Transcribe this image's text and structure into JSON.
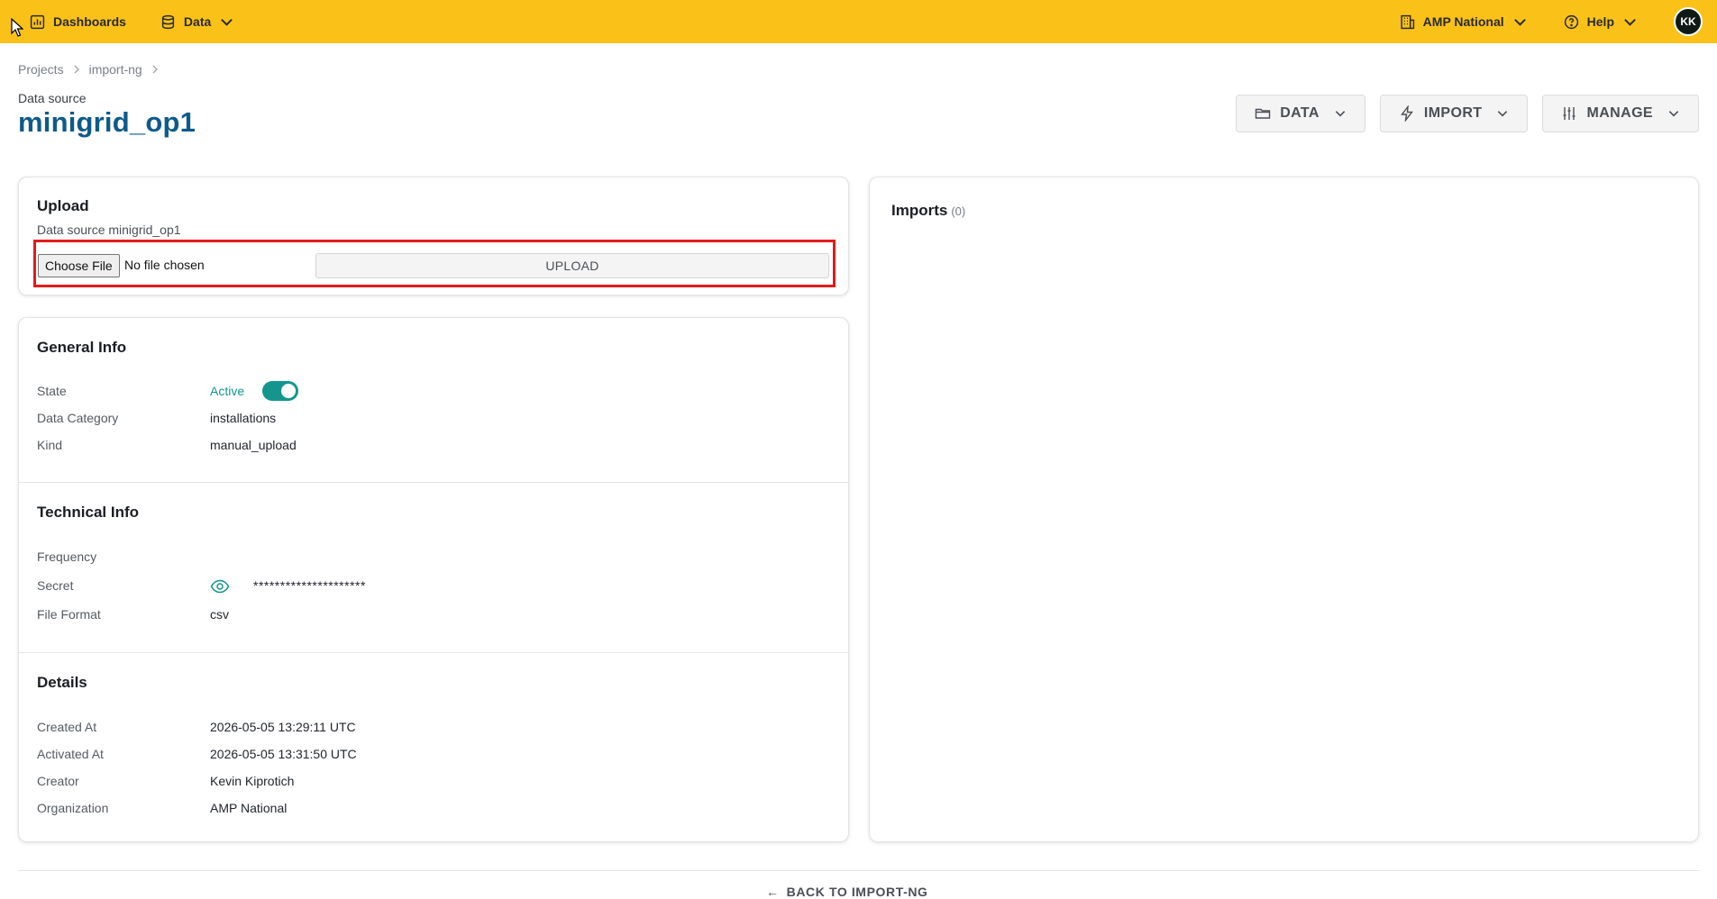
{
  "topbar": {
    "dashboards_label": "Dashboards",
    "data_label": "Data",
    "org_label": "AMP National",
    "help_label": "Help",
    "avatar_initials": "KK"
  },
  "breadcrumb": [
    "Projects",
    "import-ng"
  ],
  "header": {
    "subtitle": "Data source",
    "title": "minigrid_op1"
  },
  "actions": [
    {
      "label": "DATA",
      "icon": "folder-icon"
    },
    {
      "label": "IMPORT",
      "icon": "lightning-icon"
    },
    {
      "label": "MANAGE",
      "icon": "sliders-icon"
    }
  ],
  "upload": {
    "title": "Upload",
    "description": "Data source minigrid_op1",
    "choose_file_label": "Choose File",
    "file_status": "No file chosen",
    "upload_label": "UPLOAD"
  },
  "general_info": {
    "title": "General Info",
    "state_label": "State",
    "state_value": "Active",
    "state_on": true,
    "category_label": "Data Category",
    "category_value": "installations",
    "kind_label": "Kind",
    "kind_value": "manual_upload"
  },
  "technical_info": {
    "title": "Technical Info",
    "frequency_label": "Frequency",
    "frequency_value": "",
    "secret_label": "Secret",
    "secret_value": "*********************",
    "format_label": "File Format",
    "format_value": "csv"
  },
  "details": {
    "title": "Details",
    "created_label": "Created At",
    "created_value": "2026-05-05 13:29:11 UTC",
    "activated_label": "Activated At",
    "activated_value": "2026-05-05 13:31:50 UTC",
    "creator_label": "Creator",
    "creator_value": "Kevin Kiprotich",
    "org_label": "Organization",
    "org_value": "AMP National"
  },
  "imports": {
    "title": "Imports",
    "count": "(0)"
  },
  "footer": {
    "back_label": "BACK TO IMPORT-NG"
  },
  "colors": {
    "topbar": "#fac219",
    "title": "#0e5a8a",
    "accent": "#14968f",
    "highlight": "#e31b1b"
  }
}
